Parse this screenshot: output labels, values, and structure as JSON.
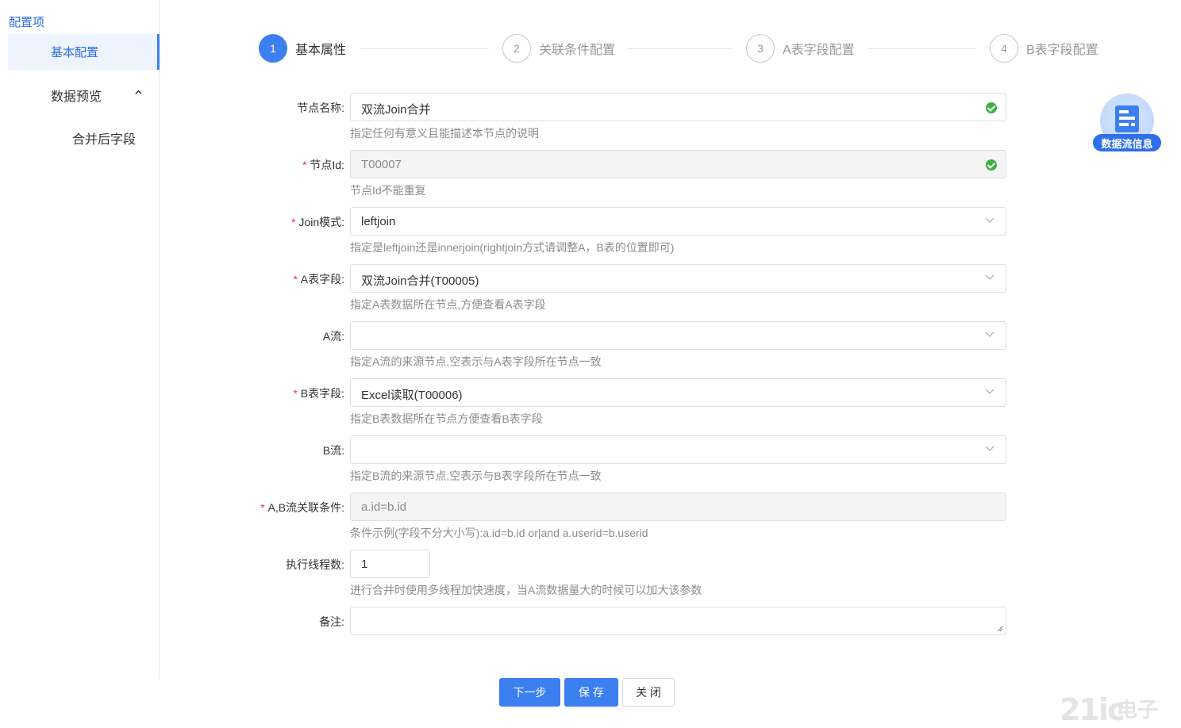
{
  "sidebar": {
    "title": "配置项",
    "active_item": "基本配置",
    "group": "数据预览",
    "sub_item": "合并后字段"
  },
  "steps": [
    {
      "num": "1",
      "title": "基本属性",
      "active": true
    },
    {
      "num": "2",
      "title": "关联条件配置",
      "active": false
    },
    {
      "num": "3",
      "title": "A表字段配置",
      "active": false
    },
    {
      "num": "4",
      "title": "B表字段配置",
      "active": false
    }
  ],
  "form": {
    "node_name": {
      "label": "节点名称:",
      "value": "双流Join合并",
      "hint": "指定任何有意义且能描述本节点的说明"
    },
    "node_id": {
      "label": "节点Id:",
      "value": "T00007",
      "hint": "节点Id不能重复"
    },
    "join_mode": {
      "label": "Join模式:",
      "value": "leftjoin",
      "hint": "指定是leftjoin还是innerjoin(rightjoin方式请调整A，B表的位置即可)"
    },
    "a_field": {
      "label": "A表字段:",
      "value": "双流Join合并(T00005)",
      "hint": "指定A表数据所在节点,方便查看A表字段"
    },
    "a_stream": {
      "label": "A流:",
      "value": "",
      "hint": "指定A流的来源节点,空表示与A表字段所在节点一致"
    },
    "b_field": {
      "label": "B表字段:",
      "value": "Excel读取(T00006)",
      "hint": "指定B表数据所在节点方便查看B表字段"
    },
    "b_stream": {
      "label": "B流:",
      "value": "",
      "hint": "指定B流的来源节点,空表示与B表字段所在节点一致"
    },
    "condition": {
      "label": "A,B流关联条件:",
      "value": "a.id=b.id",
      "hint": "条件示例(字段不分大小写):a.id=b.id or|and a.userid=b.userid"
    },
    "threads": {
      "label": "执行线程数:",
      "value": "1",
      "hint": "进行合并时使用多线程加快速度，当A流数据量大的时候可以加大该参数"
    },
    "remark": {
      "label": "备注:",
      "value": ""
    }
  },
  "float_badge": {
    "label": "数据流信息",
    "icon": "document-icon"
  },
  "buttons": {
    "next": "下一步",
    "save": "保 存",
    "close": "关 闭"
  },
  "watermark": {
    "part1": "21ic",
    "part2": "电子网"
  },
  "colors": {
    "primary": "#3b7ff0",
    "success": "#3cb043",
    "required": "#e33333"
  }
}
